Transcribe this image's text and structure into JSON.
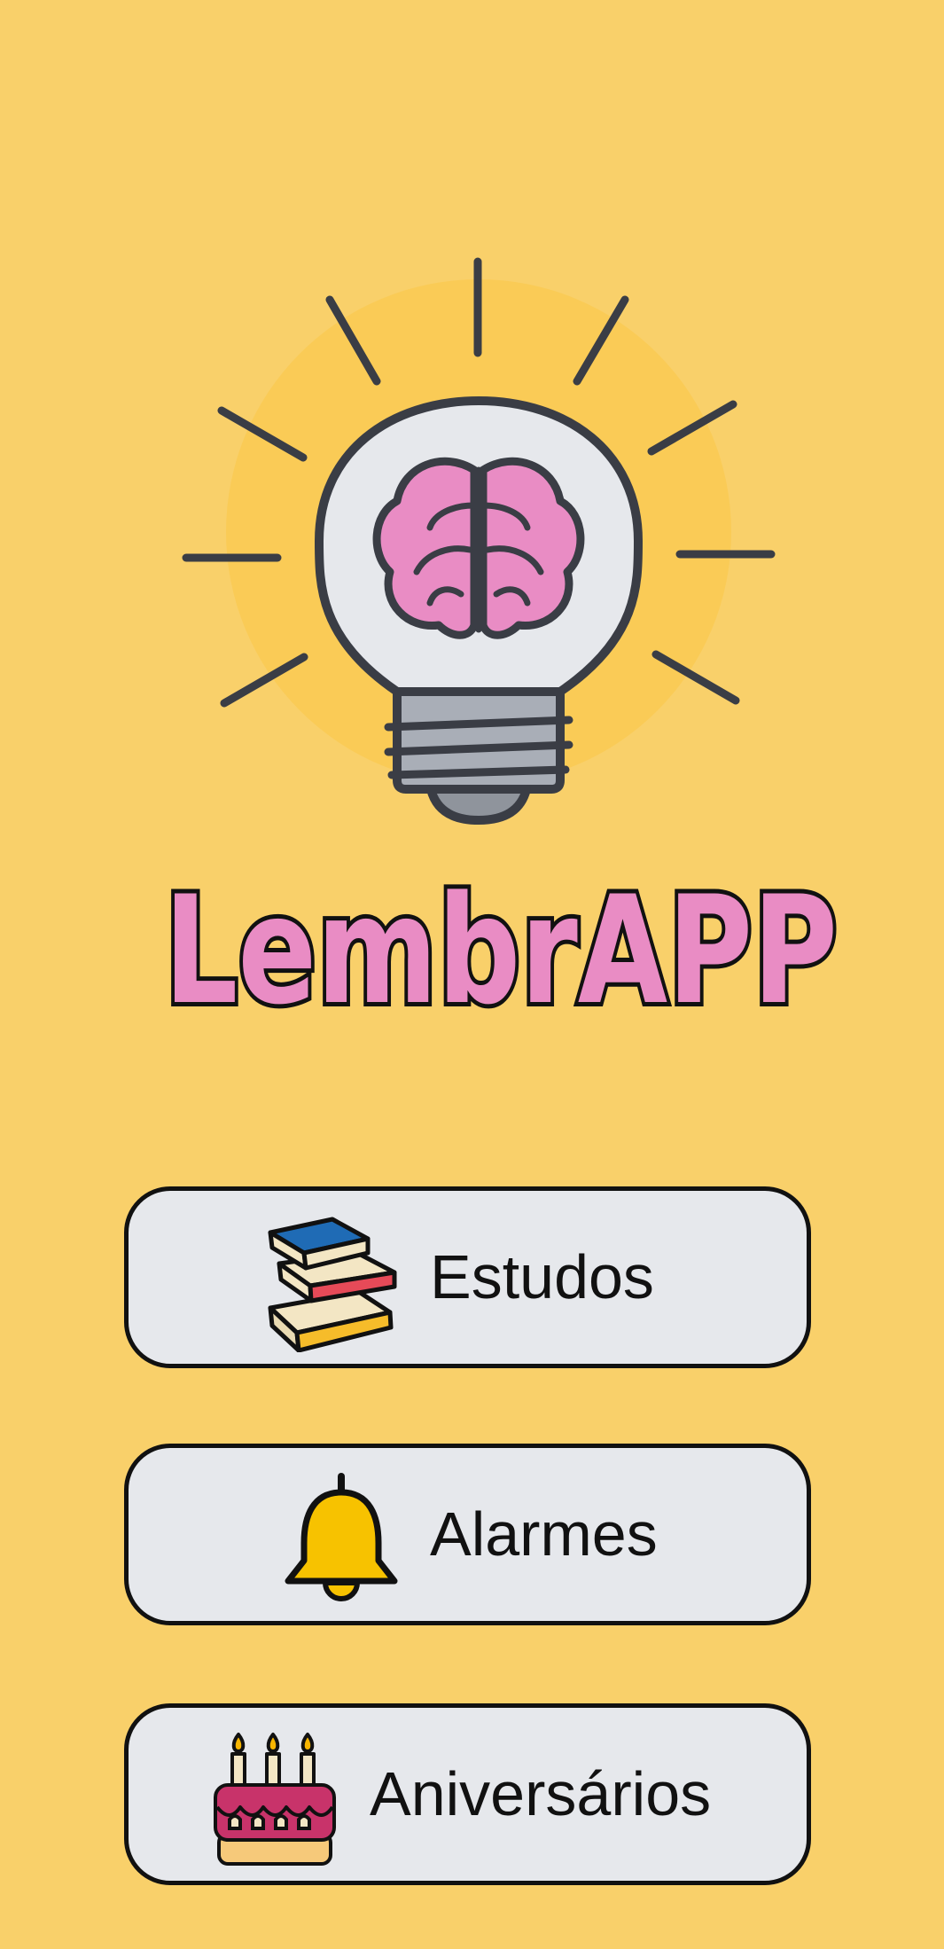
{
  "app": {
    "title": "LembrAPP"
  },
  "logo": {
    "icon": "lightbulb-brain-icon"
  },
  "menu": {
    "items": [
      {
        "label": "Estudos",
        "icon": "books-icon"
      },
      {
        "label": "Alarmes",
        "icon": "bell-icon"
      },
      {
        "label": "Aniversários",
        "icon": "birthday-cake-icon"
      }
    ]
  },
  "colors": {
    "background": "#F9D06A",
    "button_fill": "#E6E8EC",
    "title_fill": "#E98CC4",
    "brain": "#E98CC4"
  }
}
